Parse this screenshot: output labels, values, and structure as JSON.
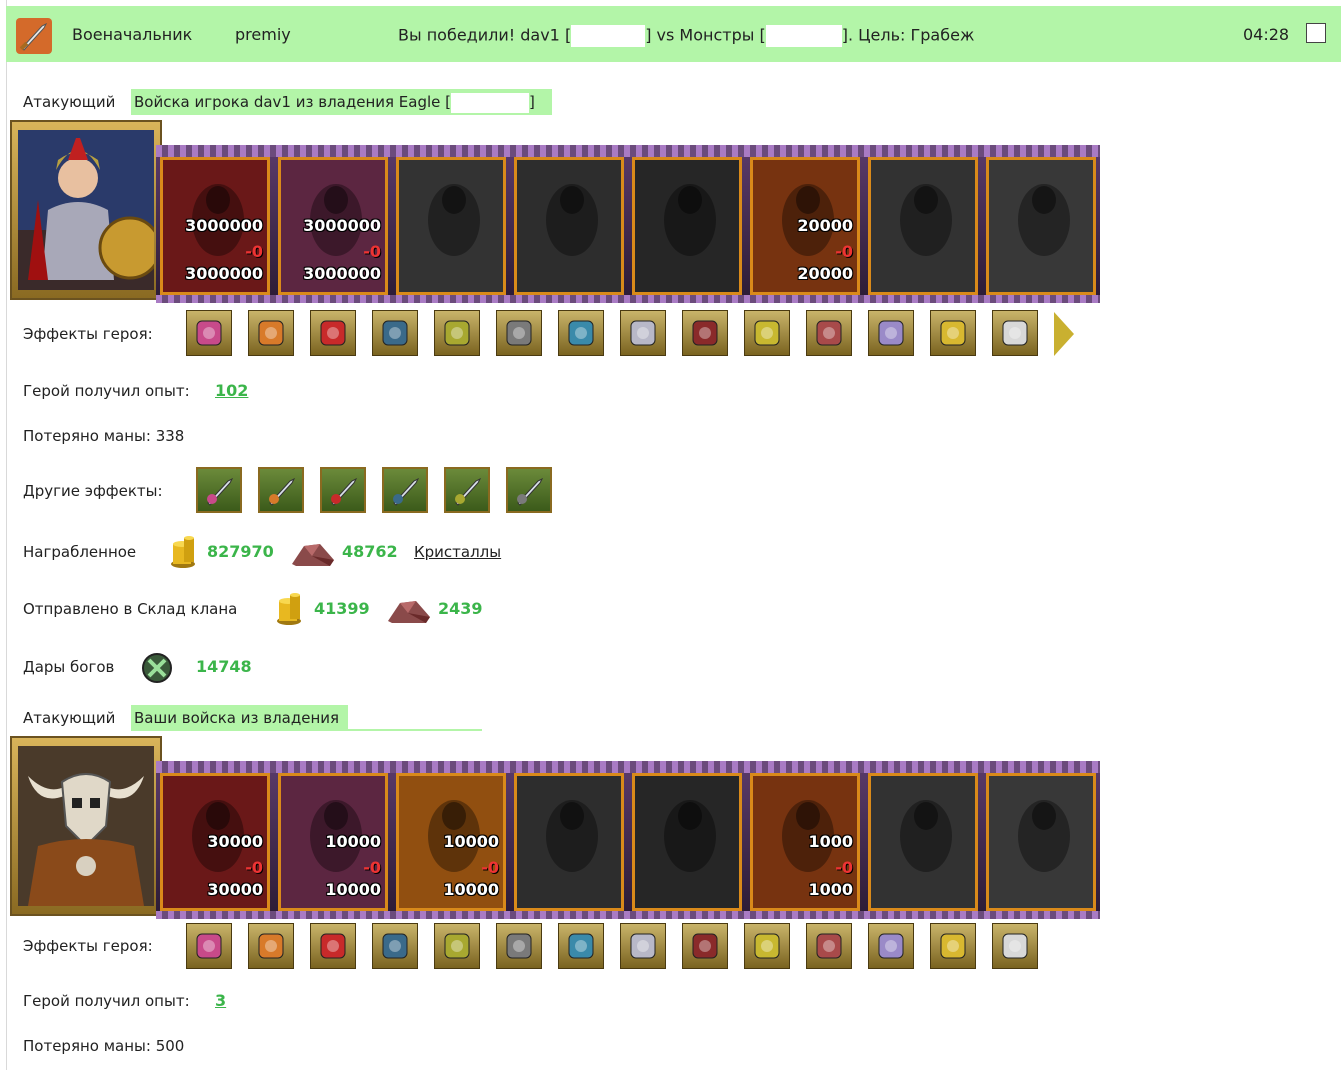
{
  "header": {
    "rank": "Военачальник",
    "player": "premiy",
    "battle_result_prefix": "Вы победили! dav1 [",
    "vs_text": "] vs Монстры [",
    "goal_text": "]. Цель: Грабеж",
    "time": "04:28"
  },
  "army1": {
    "label": "Атакующий",
    "title_prefix": "Войска игрока dav1 из владения Eagle [",
    "title_suffix": "]",
    "units": [
      {
        "top": "3000000",
        "loss": "-0",
        "bottom": "3000000",
        "color": "#7a1a1a"
      },
      {
        "top": "3000000",
        "loss": "-0",
        "bottom": "3000000",
        "color": "#6a2a4a"
      },
      {
        "top": "",
        "loss": "",
        "bottom": "",
        "color": "#3a3a3a"
      },
      {
        "top": "",
        "loss": "",
        "bottom": "",
        "color": "#333333"
      },
      {
        "top": "",
        "loss": "",
        "bottom": "",
        "color": "#2a2a2a"
      },
      {
        "top": "20000",
        "loss": "-0",
        "bottom": "20000",
        "color": "#8a3a10"
      },
      {
        "top": "",
        "loss": "",
        "bottom": "",
        "color": "#383838"
      },
      {
        "top": "",
        "loss": "",
        "bottom": "",
        "color": "#404040"
      }
    ],
    "effects_label": "Эффекты героя:",
    "exp_label": "Герой получил опыт:",
    "exp_value": "102",
    "mana_label": "Потеряно маны: 338",
    "other_label": "Другие эффекты:",
    "loot_label": "Награбленное",
    "gold": "827970",
    "ore": "48762",
    "crystals_link": "Кристаллы",
    "sent_label": "Отправлено в Склад клана",
    "sent_gold": "41399",
    "sent_ore": "2439",
    "gifts_label": "Дары богов",
    "gifts_value": "14748"
  },
  "army2": {
    "label": "Атакующий",
    "title": "Ваши войска из владения",
    "units": [
      {
        "top": "30000",
        "loss": "-0",
        "bottom": "30000",
        "color": "#7a1a1a"
      },
      {
        "top": "10000",
        "loss": "-0",
        "bottom": "10000",
        "color": "#6a2a4a"
      },
      {
        "top": "10000",
        "loss": "-0",
        "bottom": "10000",
        "color": "#a85a10"
      },
      {
        "top": "",
        "loss": "",
        "bottom": "",
        "color": "#333333"
      },
      {
        "top": "",
        "loss": "",
        "bottom": "",
        "color": "#2a2a2a"
      },
      {
        "top": "1000",
        "loss": "-0",
        "bottom": "1000",
        "color": "#8a3a10"
      },
      {
        "top": "",
        "loss": "",
        "bottom": "",
        "color": "#383838"
      },
      {
        "top": "",
        "loss": "",
        "bottom": "",
        "color": "#404040"
      }
    ],
    "effects_label": "Эффекты героя:",
    "exp_label": "Герой получил опыт:",
    "exp_value": "3",
    "mana_label": "Потеряно маны: 500"
  },
  "icon_names": {
    "hero1_effects": [
      "gift-box-icon",
      "treasure-chest-icon",
      "heart-icon",
      "shield-icon",
      "gold-ore-icon",
      "armor-icon",
      "blue-gem-icon",
      "scroll-stack-icon",
      "amulet-icon",
      "gold-armor-icon",
      "bracelet-icon",
      "silver-ring-icon",
      "golden-harp-icon",
      "key-icon"
    ],
    "other_effects": [
      "xp-boost-icon",
      "green-sword-icon",
      "blue-sword-icon",
      "fist-sword-icon",
      "fist-sword-icon",
      "fist-sword-icon"
    ],
    "hero2_effects": [
      "gold-ore-icon",
      "armor-icon",
      "blue-gem-icon",
      "tribal-mask-icon",
      "amulet-icon",
      "crystal-armor-icon",
      "purple-ring-icon",
      "gold-ring-icon",
      "tankard-icon",
      "wand-icon",
      "round-shield-icon",
      "scroll-icon",
      "red-cloak-icon",
      "blue-boots-icon"
    ]
  }
}
